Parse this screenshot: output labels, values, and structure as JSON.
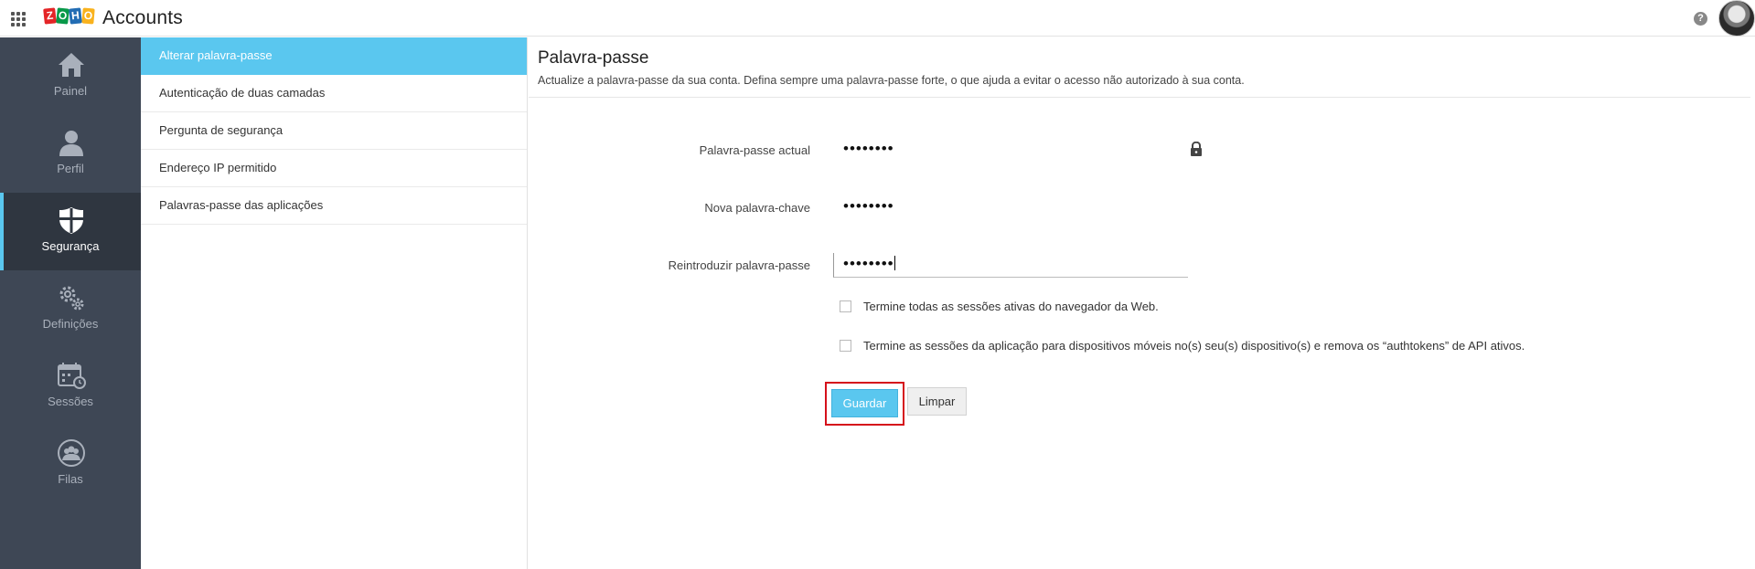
{
  "header": {
    "logo_letters": [
      "Z",
      "O",
      "H",
      "O"
    ],
    "logo_colors": [
      "#e42527",
      "#089949",
      "#226db4",
      "#f9b21d"
    ],
    "app_name": "Accounts",
    "help_glyph": "?"
  },
  "leftnav": {
    "items": [
      {
        "label": "Painel",
        "icon": "home-icon"
      },
      {
        "label": "Perfil",
        "icon": "user-icon"
      },
      {
        "label": "Segurança",
        "icon": "shield-icon",
        "active": true
      },
      {
        "label": "Definições",
        "icon": "gears-icon"
      },
      {
        "label": "Sessões",
        "icon": "calendar-clock-icon"
      },
      {
        "label": "Filas",
        "icon": "group-icon"
      }
    ]
  },
  "submenu": {
    "items": [
      {
        "label": "Alterar palavra-passe",
        "active": true
      },
      {
        "label": "Autenticação de duas camadas"
      },
      {
        "label": "Pergunta de segurança"
      },
      {
        "label": "Endereço IP permitido"
      },
      {
        "label": "Palavras-passe das aplicações"
      }
    ]
  },
  "main": {
    "title": "Palavra-passe",
    "description": "Actualize a palavra-passe da sua conta. Defina sempre uma palavra-passe forte, o que ajuda a evitar o acesso não autorizado à sua conta.",
    "fields": {
      "current": {
        "label": "Palavra-passe actual",
        "value": "••••••••"
      },
      "new": {
        "label": "Nova palavra-chave",
        "value": "••••••••"
      },
      "confirm": {
        "label": "Reintroduzir palavra-passe",
        "value": "••••••••"
      }
    },
    "checkboxes": {
      "web_sessions": {
        "label": "Termine todas as sessões ativas do navegador da Web.",
        "checked": false
      },
      "mobile_sessions": {
        "label": "Termine as sessões da aplicação para dispositivos móveis no(s) seu(s) dispositivo(s) e remova os “authtokens” de API ativos.",
        "checked": false
      }
    },
    "buttons": {
      "save": "Guardar",
      "clear": "Limpar"
    },
    "accent_color": "#5ac7ef",
    "highlight_color": "#d5101b"
  }
}
